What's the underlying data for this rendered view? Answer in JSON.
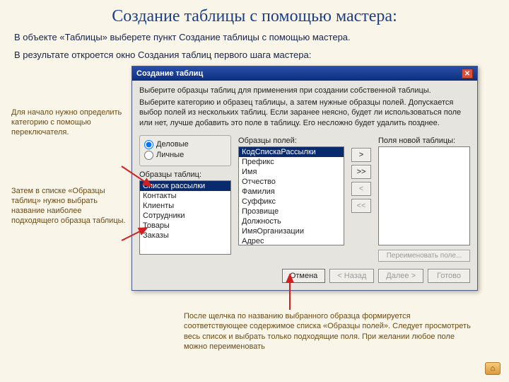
{
  "title": "Создание таблицы с помощью мастера:",
  "intro1": "В объекте «Таблицы» выберете пункт Создание таблицы с помощью мастера.",
  "intro2": "В результате откроется окно Создания таблиц первого шага мастера:",
  "notes": {
    "note1": "Для начало нужно определить категорию с помощью переключателя.",
    "note2": "Затем в списке  «Образцы таблиц» нужно выбрать название наиболее подходящего образца таблицы.",
    "bottom": "После щелчка по названию выбранного образца формируется соответствующее содержимое списка «Образцы полей». Следует просмотреть весь список и выбрать только подходящие поля. При желании любое поле можно переименовать"
  },
  "window": {
    "title": "Создание таблиц",
    "instr1": "Выберите образцы таблиц для применения при создании собственной таблицы.",
    "instr2": "Выберите категорию и образец таблицы, а затем нужные образцы полей. Допускается выбор полей из нескольких таблиц. Если заранее неясно, будет ли использоваться поле или нет, лучше добавить это поле в таблицу. Его несложно будет удалить позднее.",
    "radios": {
      "business": "Деловые",
      "personal": "Личные"
    },
    "labels": {
      "sampleTables": "Образцы таблиц:",
      "sampleFields": "Образцы полей:",
      "newFields": "Поля новой таблицы:",
      "rename": "Переименовать поле..."
    },
    "sampleTables": [
      "Список рассылки",
      "Контакты",
      "Клиенты",
      "Сотрудники",
      "Товары",
      "Заказы"
    ],
    "sampleFields": [
      "КодСпискаРассылки",
      "Префикс",
      "Имя",
      "Отчество",
      "Фамилия",
      "Суффикс",
      "Прозвище",
      "Должность",
      "ИмяОрганизации",
      "Адрес"
    ],
    "moveBtns": {
      "add": ">",
      "addAll": ">>",
      "remove": "<",
      "removeAll": "<<"
    },
    "wizard": {
      "cancel": "Отмена",
      "back": "< Назад",
      "next": "Далее >",
      "finish": "Готово"
    }
  }
}
